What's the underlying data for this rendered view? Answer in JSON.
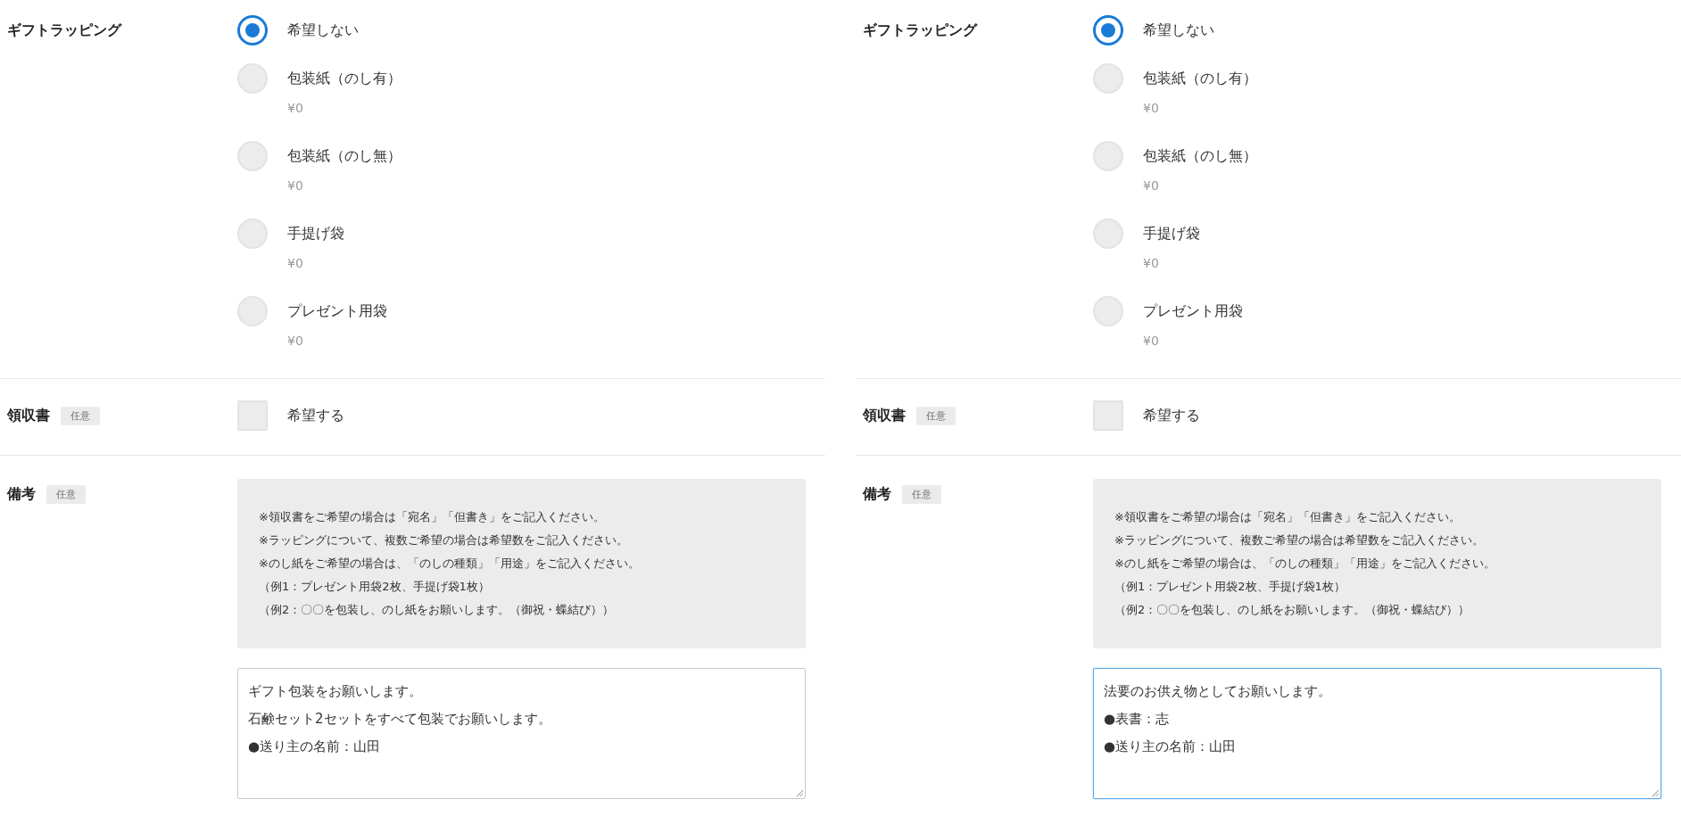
{
  "panels": [
    {
      "gift_wrapping": {
        "label": "ギフトラッピング",
        "options": [
          {
            "label": "希望しない",
            "selected": true
          },
          {
            "label": "包装紙（のし有）",
            "price": "¥0",
            "selected": false
          },
          {
            "label": "包装紙（のし無）",
            "price": "¥0",
            "selected": false
          },
          {
            "label": "手提げ袋",
            "price": "¥0",
            "selected": false
          },
          {
            "label": "プレゼント用袋",
            "price": "¥0",
            "selected": false
          }
        ]
      },
      "receipt": {
        "label": "領収書",
        "badge": "任意",
        "option": {
          "label": "希望する",
          "checked": false
        }
      },
      "remarks": {
        "label": "備考",
        "badge": "任意",
        "notes": [
          "※領収書をご希望の場合は「宛名」「但書き」をご記入ください。",
          "※ラッピングについて、複数ご希望の場合は希望数をご記入ください。",
          "※のし紙をご希望の場合は、「のしの種類」「用途」をご記入ください。",
          "（例1：プレゼント用袋2枚、手提げ袋1枚）",
          "（例2：〇〇を包装し、のし紙をお願いします。（御祝・蝶結び））"
        ],
        "value": [
          "ギフト包装をお願いします。",
          "石鹸セット2セットをすべて包装でお願いします。",
          "●送り主の名前：山田"
        ],
        "focused": false
      }
    },
    {
      "gift_wrapping": {
        "label": "ギフトラッピング",
        "options": [
          {
            "label": "希望しない",
            "selected": true
          },
          {
            "label": "包装紙（のし有）",
            "price": "¥0",
            "selected": false
          },
          {
            "label": "包装紙（のし無）",
            "price": "¥0",
            "selected": false
          },
          {
            "label": "手提げ袋",
            "price": "¥0",
            "selected": false
          },
          {
            "label": "プレゼント用袋",
            "price": "¥0",
            "selected": false
          }
        ]
      },
      "receipt": {
        "label": "領収書",
        "badge": "任意",
        "option": {
          "label": "希望する",
          "checked": false
        }
      },
      "remarks": {
        "label": "備考",
        "badge": "任意",
        "notes": [
          "※領収書をご希望の場合は「宛名」「但書き」をご記入ください。",
          "※ラッピングについて、複数ご希望の場合は希望数をご記入ください。",
          "※のし紙をご希望の場合は、「のしの種類」「用途」をご記入ください。",
          "（例1：プレゼント用袋2枚、手提げ袋1枚）",
          "（例2：〇〇を包装し、のし紙をお願いします。（御祝・蝶結び））"
        ],
        "value": [
          "法要のお供え物としてお願いします。",
          "●表書：志",
          "●送り主の名前：山田"
        ],
        "focused": true
      }
    }
  ]
}
